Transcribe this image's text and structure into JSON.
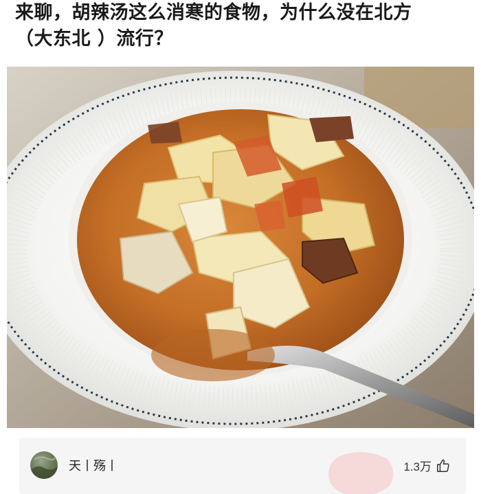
{
  "question": {
    "title_line1": "来聊，胡辣汤这么消寒的食物，为什么没在北方",
    "title_line2": "（大东北 ）流行？"
  },
  "answer": {
    "author_name": "天丨殇丨",
    "like_count": "1.3万"
  },
  "colors": {
    "title_text": "#1a1a1a",
    "card_background": "#f5f5f5",
    "soup_broth": "#c9742a",
    "watermark": "#f2a7a7"
  },
  "icons": {
    "like": "thumbs-up-icon",
    "avatar": "avatar-image",
    "watermark": "stamp-watermark"
  }
}
